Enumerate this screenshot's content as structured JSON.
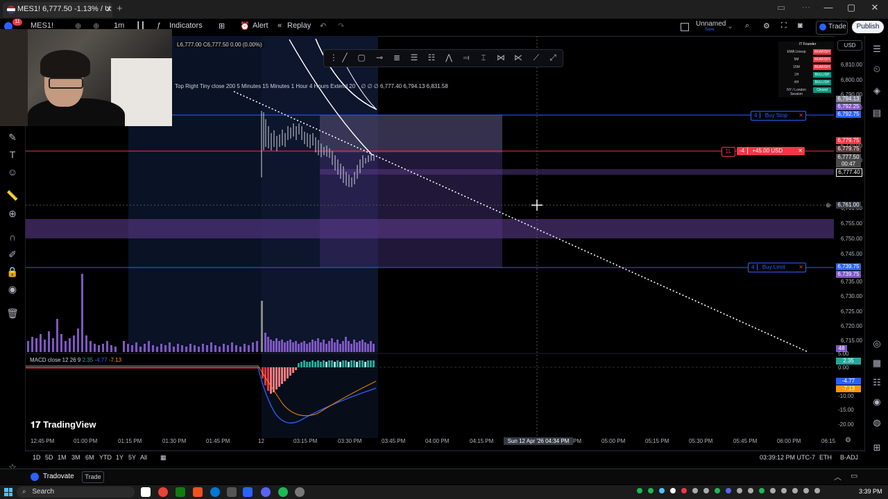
{
  "browser": {
    "tab_title": "MES1! 6,777.50 -1.13% / U",
    "new_tab": "+",
    "minimize": "—",
    "maximize": "▢",
    "close": "✕"
  },
  "toolbar": {
    "symbol": "MES1!",
    "interval": "1m",
    "indicators": "Indicators",
    "alert": "Alert",
    "replay": "Replay",
    "layout_name": "Unnamed",
    "layout_sub": "Save",
    "trade": "Trade",
    "publish": "Publish",
    "currency": "USD",
    "badge_count": "11"
  },
  "legend": {
    "ohlc": "L6,777.00 C6,777.50 0.00 (0.00%)",
    "indicator_line": "Top Right Tiny close 200 5 Minutes 15 Minutes 1 Hour 4 Hours Extend 20",
    "indicator_values": "∅ ∅ ∅ 6,777.40 6,794.13 6,831.58"
  },
  "orders": {
    "buy_stop": {
      "qty": "4",
      "label": "Buy Stop",
      "price": "6,792.75",
      "color": "#2962ff"
    },
    "position": {
      "qty": "-4",
      "side": "1L",
      "pnl": "+45.00 USD",
      "price": "6,779.75",
      "color": "#f23645"
    },
    "buy_limit": {
      "qty": "4",
      "label": "Buy Limit",
      "price": "6,739.75",
      "color": "#2962ff"
    }
  },
  "price_axis": [
    "6,810.00",
    "6,800.00",
    "6,790.00",
    "6,785.00",
    "6,770.00",
    "6,765.00",
    "6,761.00",
    "6,755.00",
    "6,750.00",
    "6,745.00",
    "6,735.00",
    "6,730.00",
    "6,725.00",
    "6,720.00",
    "6,715.00"
  ],
  "price_tags": {
    "top1": "6,794.13",
    "top2": "6,792.25",
    "position": "6,779.75",
    "last": "6,777.50",
    "countdown": "00:47",
    "ma": "6,777.40",
    "cursor": "6,761.00",
    "limit1": "6,739.75",
    "limit2": "6,739.75",
    "vol": "48"
  },
  "status_table": {
    "title": "IT Founder",
    "rows": [
      {
        "label": "EMA Lineup",
        "value": "BEARISH",
        "color": "#f23645"
      },
      {
        "label": "5M",
        "value": "BEARISH",
        "color": "#f23645"
      },
      {
        "label": "15M",
        "value": "BEARISH",
        "color": "#f23645"
      },
      {
        "label": "1H",
        "value": "BULLISH",
        "color": "#089981"
      },
      {
        "label": "4H",
        "value": "BULLISH",
        "color": "#089981"
      },
      {
        "label": "NY / London Session",
        "value": "Closed",
        "color": "#089981"
      }
    ]
  },
  "macd": {
    "label": "MACD close 12 26 9",
    "v1": "2.35",
    "v2": "-4.77",
    "v3": "-7.13",
    "axis": [
      "5.00",
      "0.00",
      "-4.77",
      "-7.13",
      "-10.00",
      "-15.00",
      "-20.00"
    ],
    "tag1": "2.35"
  },
  "time_axis": [
    "12:45 PM",
    "01:00 PM",
    "01:15 PM",
    "01:30 PM",
    "01:45 PM",
    "12",
    "03:15 PM",
    "03:30 PM",
    "03:45 PM",
    "04:00 PM",
    "04:15 PM",
    "PM",
    "05:00 PM",
    "05:15 PM",
    "05:30 PM",
    "05:45 PM",
    "06:00 PM",
    "06:15"
  ],
  "time_cursor": "Sun 12 Apr '26   04:34 PM",
  "logo": "TradingView",
  "range_bar": {
    "ranges": [
      "1D",
      "5D",
      "1M",
      "3M",
      "6M",
      "YTD",
      "1Y",
      "5Y",
      "All"
    ],
    "clock": "03:39:12 PM UTC-7",
    "session": "ETH",
    "adj": "B-ADJ"
  },
  "tradovate": {
    "broker": "Tradovate",
    "trade": "Trade"
  },
  "taskbar": {
    "search": "Search",
    "time": "3:39 PM"
  }
}
